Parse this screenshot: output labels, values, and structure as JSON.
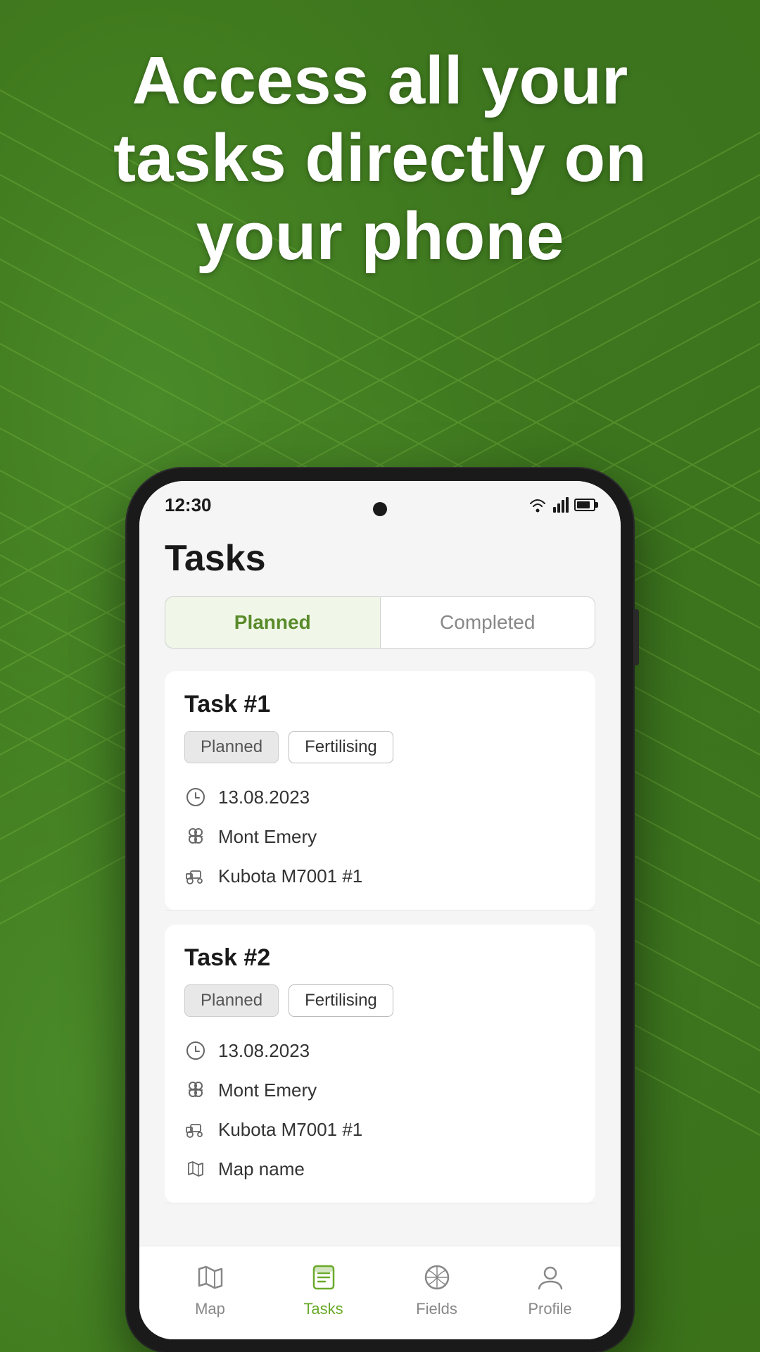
{
  "hero": {
    "title": "Access all your tasks directly on your phone"
  },
  "phone": {
    "status_bar": {
      "time": "12:30"
    },
    "app": {
      "title": "Tasks",
      "tabs": [
        {
          "id": "planned",
          "label": "Planned",
          "active": true
        },
        {
          "id": "completed",
          "label": "Completed",
          "active": false
        }
      ],
      "tasks": [
        {
          "id": "task1",
          "title": "Task #1",
          "tags": [
            "Planned",
            "Fertilising"
          ],
          "date": "13.08.2023",
          "location": "Mont Emery",
          "equipment": "Kubota M7001 #1",
          "map": null
        },
        {
          "id": "task2",
          "title": "Task #2",
          "tags": [
            "Planned",
            "Fertilising"
          ],
          "date": "13.08.2023",
          "location": "Mont Emery",
          "equipment": "Kubota M7001 #1",
          "map": "Map name"
        }
      ]
    },
    "bottom_nav": [
      {
        "id": "map",
        "label": "Map",
        "active": false
      },
      {
        "id": "tasks",
        "label": "Tasks",
        "active": true
      },
      {
        "id": "fields",
        "label": "Fields",
        "active": false
      },
      {
        "id": "profile",
        "label": "Profile",
        "active": false
      }
    ]
  },
  "colors": {
    "active_tab_bg": "#f0f7e8",
    "active_tab_text": "#5a8a2a",
    "active_nav_text": "#6aaa2a",
    "tag_planned_bg": "#e8e8e8",
    "divider": "#e8e8e8"
  }
}
